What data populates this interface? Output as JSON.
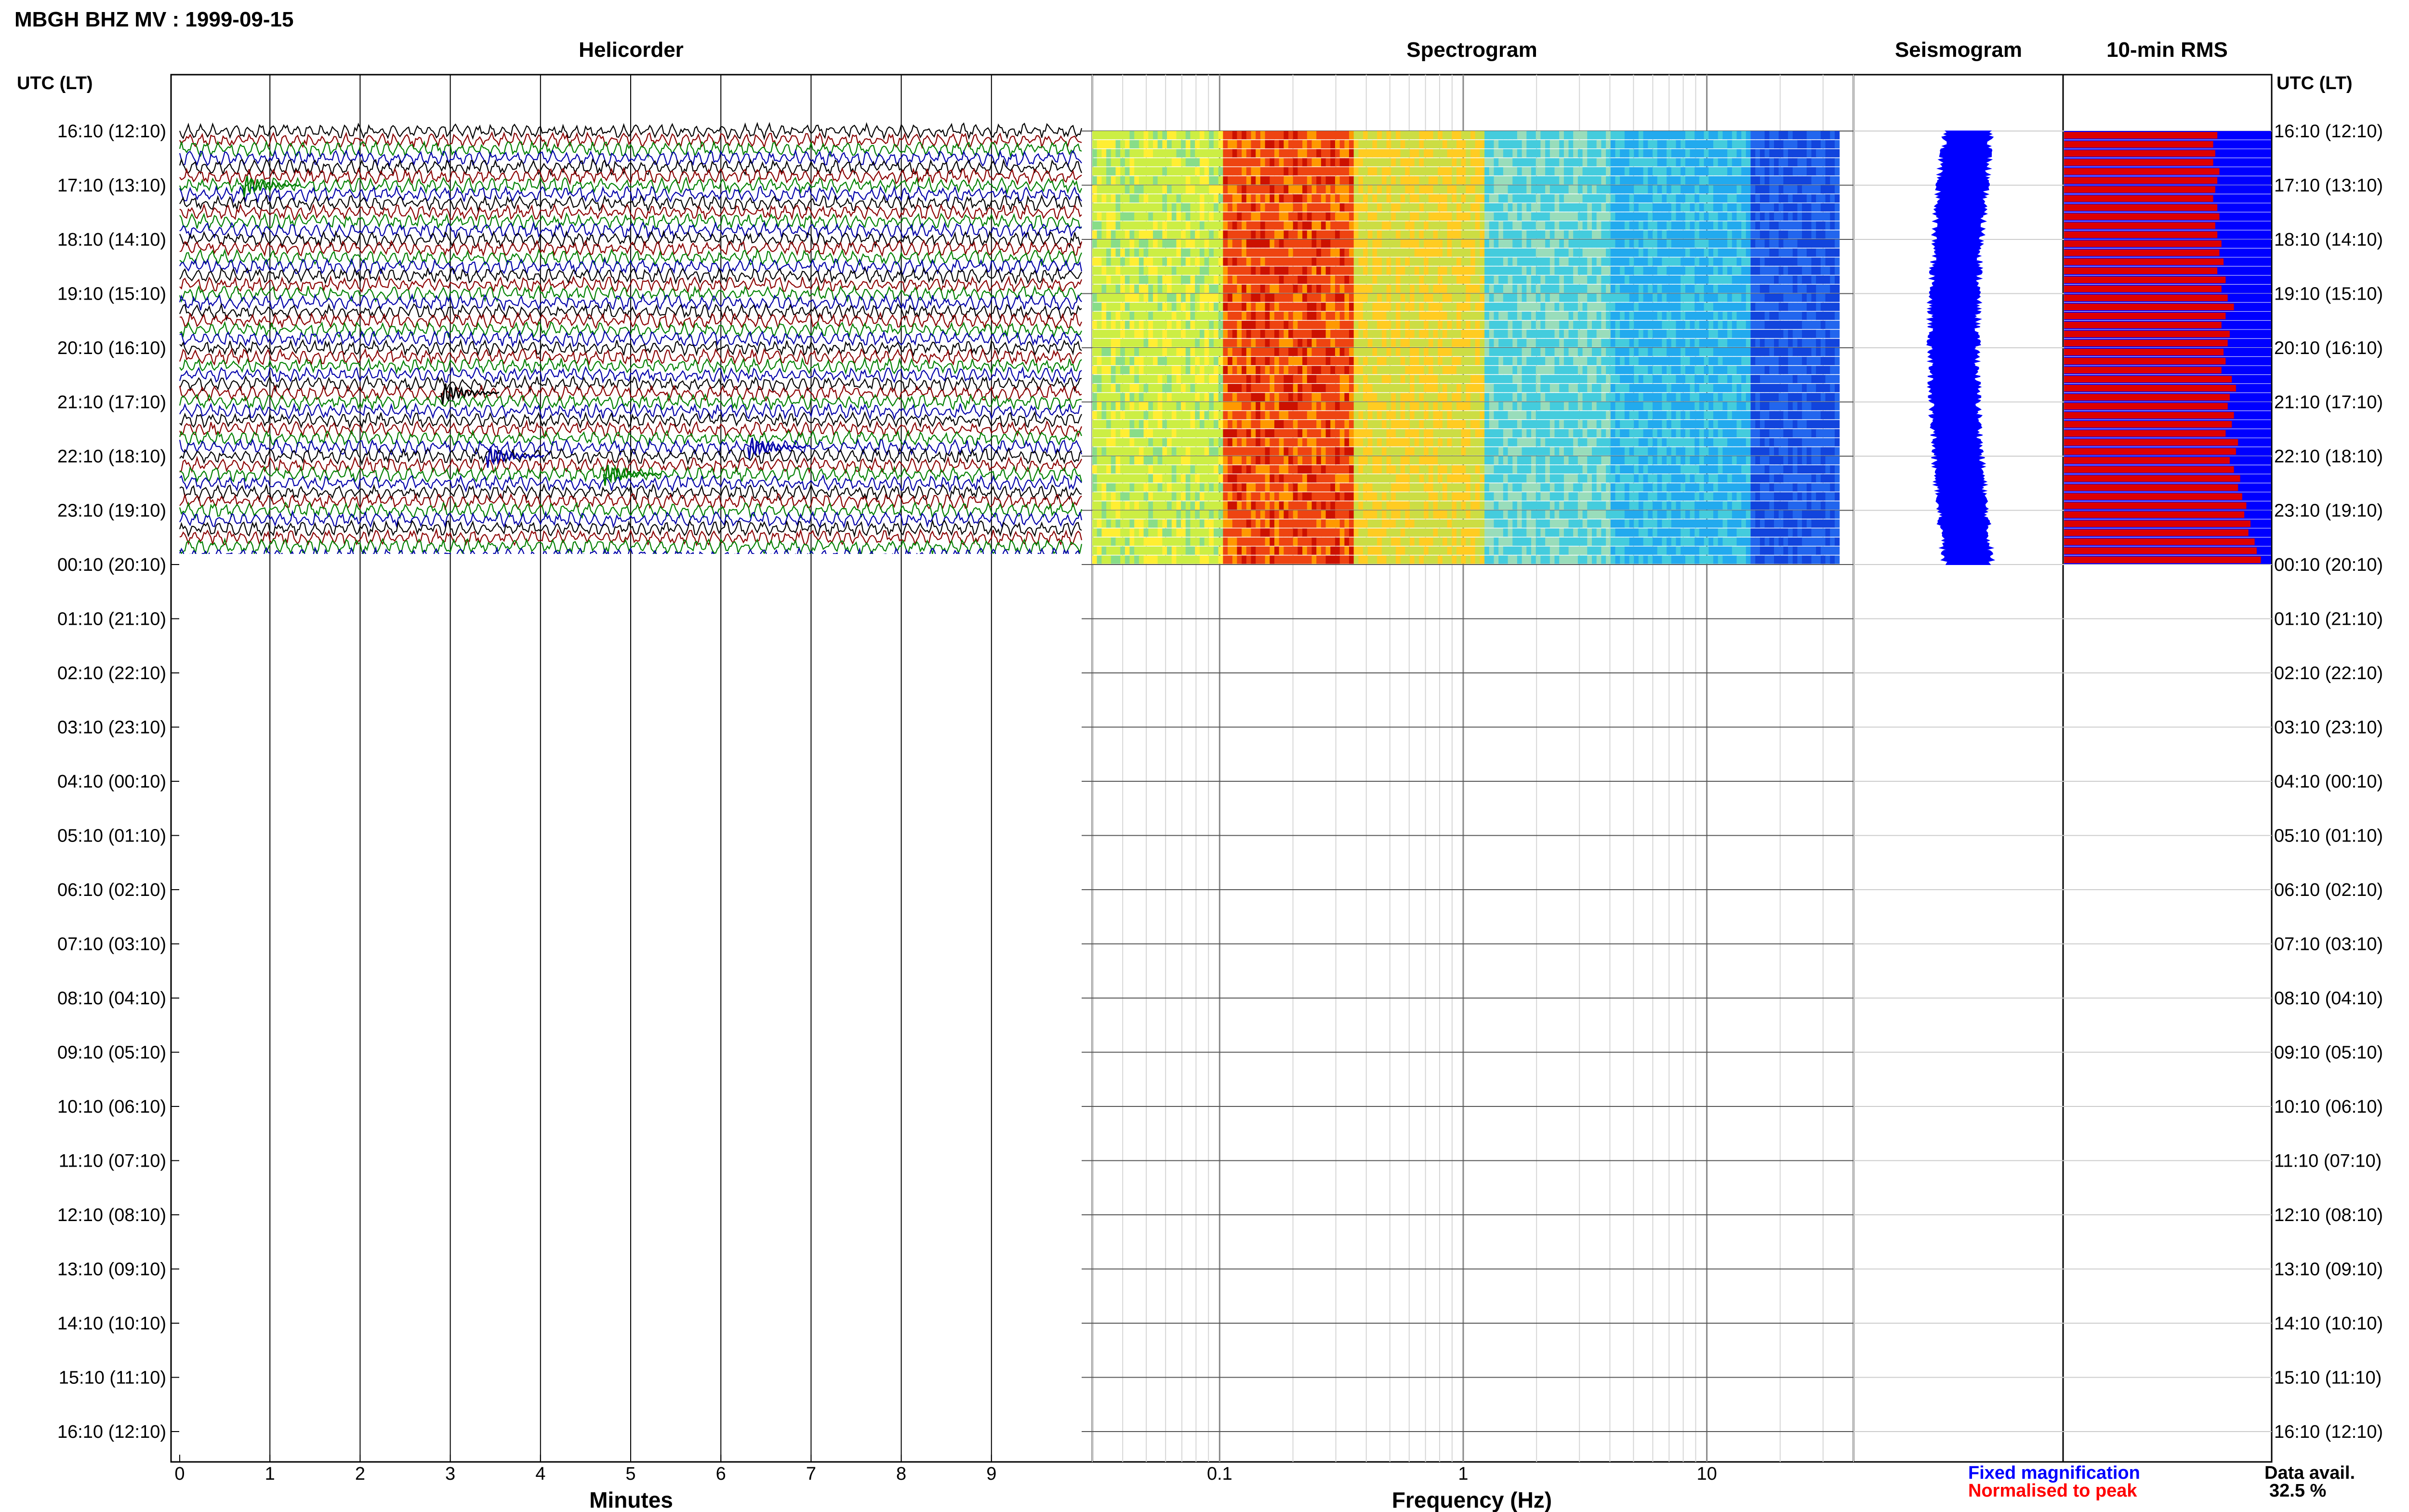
{
  "page": {
    "title": "MBGH BHZ MV : 1999-09-15",
    "utc_label_left": "UTC (LT)",
    "utc_label_right": "UTC (LT)"
  },
  "panels": {
    "helicorder": "Helicorder",
    "spectrogram": "Spectrogram",
    "seismogram": "Seismogram",
    "rms": "10-min RMS"
  },
  "axes": {
    "helicorder_xlabel": "Minutes",
    "spectrogram_xlabel": "Frequency (Hz)",
    "helicorder_ticks": [
      "0",
      "1",
      "2",
      "3",
      "4",
      "5",
      "6",
      "7",
      "8",
      "9"
    ],
    "spectrogram_ticks": [
      "0.1",
      "1",
      "10"
    ]
  },
  "time_labels": [
    "16:10 (12:10)",
    "17:10 (13:10)",
    "18:10 (14:10)",
    "19:10 (15:10)",
    "20:10 (16:10)",
    "21:10 (17:10)",
    "22:10 (18:10)",
    "23:10 (19:10)",
    "00:10 (20:10)",
    "01:10 (21:10)",
    "02:10 (22:10)",
    "03:10 (23:10)",
    "04:10 (00:10)",
    "05:10 (01:10)",
    "06:10 (02:10)",
    "07:10 (03:10)",
    "08:10 (04:10)",
    "09:10 (05:10)",
    "10:10 (06:10)",
    "11:10 (07:10)",
    "12:10 (08:10)",
    "13:10 (09:10)",
    "14:10 (10:10)",
    "15:10 (11:10)",
    "16:10 (12:10)"
  ],
  "legend": {
    "fixed": "Fixed magnification",
    "normalised": "Normalised to peak",
    "fixed_color": "#0000ff",
    "normalised_color": "#ff0000"
  },
  "availability": {
    "label": "Data avail.",
    "value": "32.5 %"
  },
  "colors": {
    "trace_cycle": [
      "#000000",
      "#8b0000",
      "#008000",
      "#0000aa"
    ],
    "rms_fixed": "#0000ff",
    "rms_normalised": "#dd0000"
  },
  "chart_data": [
    {
      "type": "line",
      "title": "Helicorder",
      "xlabel": "Minutes",
      "xlim": [
        0,
        10
      ],
      "ylim_hours": [
        0,
        24
      ],
      "rows_filled": 48,
      "row_minutes": 10
    },
    {
      "type": "heatmap",
      "title": "Spectrogram",
      "xlabel": "Frequency (Hz)",
      "xscale": "log",
      "xlim": [
        0.03,
        40
      ],
      "rows_filled": 48,
      "dominant_band_hz": [
        0.12,
        0.3
      ]
    },
    {
      "type": "bar",
      "title": "10-min RMS",
      "series": [
        {
          "name": "Fixed magnification",
          "values": [
            1,
            1,
            1,
            1,
            1,
            1,
            1,
            1,
            1,
            1,
            1,
            1,
            1,
            1,
            1,
            1,
            1,
            1,
            1,
            1,
            1,
            1,
            1,
            1,
            1,
            1,
            1,
            1,
            1,
            1,
            1,
            1,
            1,
            1,
            1,
            1,
            1,
            1,
            1,
            1,
            1,
            1,
            1,
            1,
            1,
            1,
            1,
            1
          ]
        },
        {
          "name": "Normalised to peak",
          "values": [
            0.74,
            0.72,
            0.73,
            0.72,
            0.75,
            0.74,
            0.73,
            0.72,
            0.74,
            0.75,
            0.73,
            0.74,
            0.76,
            0.75,
            0.77,
            0.74,
            0.78,
            0.76,
            0.79,
            0.82,
            0.78,
            0.76,
            0.8,
            0.79,
            0.77,
            0.78,
            0.76,
            0.81,
            0.83,
            0.8,
            0.79,
            0.82,
            0.81,
            0.78,
            0.84,
            0.83,
            0.8,
            0.82,
            0.85,
            0.84,
            0.86,
            0.88,
            0.87,
            0.9,
            0.89,
            0.92,
            0.93,
            0.95
          ]
        }
      ]
    }
  ]
}
